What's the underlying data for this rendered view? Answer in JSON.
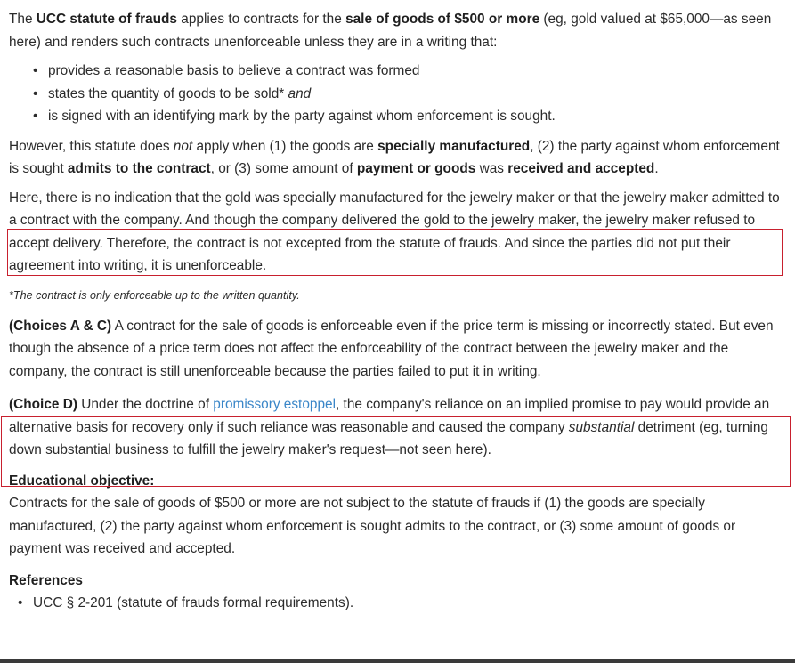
{
  "intro": {
    "t1": "The ",
    "b1": "UCC statute of frauds",
    "t2": " applies to contracts for the ",
    "b2": "sale of goods of $500 or more",
    "t3": " (eg, gold valued at $65,000—as seen here) and renders such contracts unenforceable unless they are in a writing that:"
  },
  "requirements": {
    "item1": "provides a reasonable basis to believe a contract was formed",
    "item2_text": "states the quantity of goods to be sold* ",
    "item2_em": "and",
    "item3": "is signed with an identifying mark by the party against whom enforcement is sought."
  },
  "exceptions": {
    "t1": "However, this statute does ",
    "em1": "not",
    "t2": " apply when (1) the goods are ",
    "b1": "specially manufactured",
    "t3": ", (2) the party against whom enforcement is sought ",
    "b2": "admits to the contract",
    "t4": ", or (3) some amount of ",
    "b3": "payment or goods",
    "t5": " was ",
    "b4": "received and accepted",
    "t6": "."
  },
  "analysis": "Here, there is no indication that the gold was specially manufactured for the jewelry maker or that the jewelry maker admitted to a contract with the company.  And though the company delivered the gold to the jewelry maker, the jewelry maker refused to accept delivery.  Therefore, the contract is not excepted from the statute of frauds.  And since the parties did not put their agreement into writing, it is unenforceable.",
  "footnote": "*The contract is only enforceable up to the written quantity.",
  "choice_ac": {
    "label": "(Choices A & C)",
    "text": "  A contract for the sale of goods is enforceable even if the price term is missing or incorrectly stated.  But even though the absence of a price term does not affect the enforceability of the contract between the jewelry maker and the company, the contract is still unenforceable because the parties failed to put it in writing."
  },
  "choice_d": {
    "label": "(Choice D)",
    "t1": "  Under the doctrine of ",
    "link": "promissory estoppel",
    "t2": ", the company's reliance on an implied promise to pay would provide an alternative basis for recovery only if such reliance was reasonable and caused the company ",
    "em": "substantial",
    "t3": " detriment (eg, turning down substantial business to fulfill the jewelry maker's request—not seen here)."
  },
  "objective": {
    "heading": "Educational objective:",
    "text": "Contracts for the sale of goods of $500 or more are not subject to the statute of frauds if (1) the goods are specially manufactured, (2) the party against whom enforcement is sought admits to the contract, or (3) some amount of goods or payment was received and accepted."
  },
  "references": {
    "heading": "References",
    "items": [
      "UCC § 2-201 (statute of frauds formal requirements)."
    ]
  },
  "colors": {
    "highlight_border": "#c8202e",
    "link": "#3a86c8"
  }
}
